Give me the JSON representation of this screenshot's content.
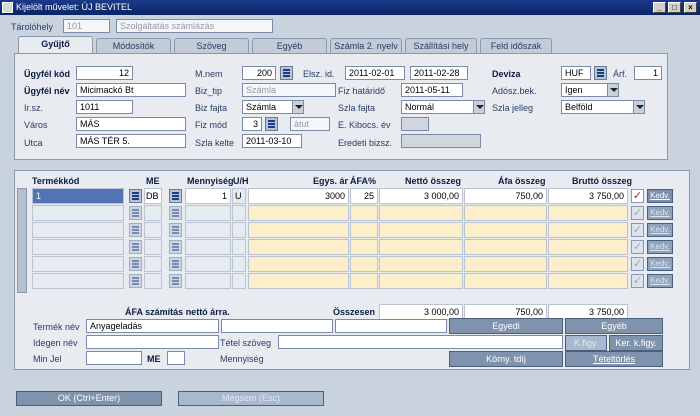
{
  "window": {
    "title": "Kijelölt művelet: ÚJ BEVITEL"
  },
  "header": {
    "tarolohely_label": "Tárolóhely",
    "tarolohely_value": "101",
    "szolgaltatas_value": "Szolgáltatás számlázás"
  },
  "tabs": [
    "Gyűjtő",
    "Módosítók",
    "Szöveg",
    "Egyéb",
    "Számla 2. nyelv",
    "Szállítási hely",
    "Feld időszak"
  ],
  "form": {
    "ugyfelkod_label": "Ügyfél kód",
    "ugyfelkod_value": "12",
    "ugyfelnev_label": "Ügyfél név",
    "ugyfelnev_value": "Micimackó Bt",
    "irsz_label": "Ir.sz.",
    "irsz_value": "1011",
    "varos_label": "Város",
    "varos_value": "MÁS",
    "utca_label": "Utca",
    "utca_value": "MÁS TÉR 5.",
    "mnem_label": "M.nem",
    "mnem_value": "200",
    "elszid_label": "Elsz. id.",
    "elszid_from": "2011-02-01",
    "elszid_to": "2011-02-28",
    "biztip_label": "Biz_tip",
    "biztip_value": "Számla",
    "fizhatarido_label": "Fiz határidő",
    "fizhatarido_value": "2011-05-11",
    "bizfajta_label": "Biz fajta",
    "bizfajta_value": "Számla",
    "szlafajta_label": "Szla fajta",
    "szlafajta_value": "Normál",
    "fizmod_label": "Fiz mód",
    "fizmod_value": "3",
    "fizmod_text": "átut",
    "ekibocs_label": "E. Kibocs. év",
    "szlakelte_label": "Szla kelte",
    "szlakelte_value": "2011-03-10",
    "eredetibizsz_label": "Eredeti bizsz.",
    "deviza_label": "Deviza",
    "deviza_value": "HUF",
    "arf_label": "Árf.",
    "arf_value": "1",
    "adoszbek_label": "Adósz.bek.",
    "adoszbek_value": "Igen",
    "szlajelleg_label": "Szla jelleg",
    "szlajelleg_value": "Belföld"
  },
  "grid": {
    "headers": {
      "termekkod": "Termékkód",
      "me": "ME",
      "mennyiseg": "Mennyiség",
      "uh": "U/H",
      "egysar": "Egys. ár",
      "afa": "ÁFA%",
      "netto": "Nettó összeg",
      "afaosszeg": "Áfa összeg",
      "brutto": "Bruttó összeg"
    },
    "row1": {
      "termekkod": "1",
      "me": "DB",
      "mennyiseg": "1",
      "uh": "U",
      "egysar": "3000",
      "afa": "25",
      "netto": "3 000,00",
      "afaosszeg": "750,00",
      "brutto": "3 750,00"
    },
    "kedv_label": "Kedv."
  },
  "footer": {
    "afa_note": "ÁFA számítás nettó árra.",
    "osszesen_label": "Összesen",
    "osszesen_netto": "3 000,00",
    "osszesen_afa": "750,00",
    "osszesen_brutto": "3 750,00",
    "termeknev_label": "Termék név",
    "termeknev_value": "Anyageladás",
    "idegennev_label": "Idegen név",
    "tetelszoveg_label": "Tétel szöveg",
    "minjel_label": "Min Jel",
    "me_label": "ME",
    "mennyiseg_label": "Mennyiség",
    "egyedi_btn": "Egyedi",
    "egyeb_btn": "Egyéb",
    "kfigy_btn": "K.figy.",
    "kerkfigy_btn": "Ker. k.figy.",
    "kornytdij_btn": "Körny. tdíj",
    "teteltorles_btn": "Tételtörlés",
    "ok_btn": "OK (Ctrl+Enter)",
    "megsem_btn": "Mégsem (Esc)"
  }
}
